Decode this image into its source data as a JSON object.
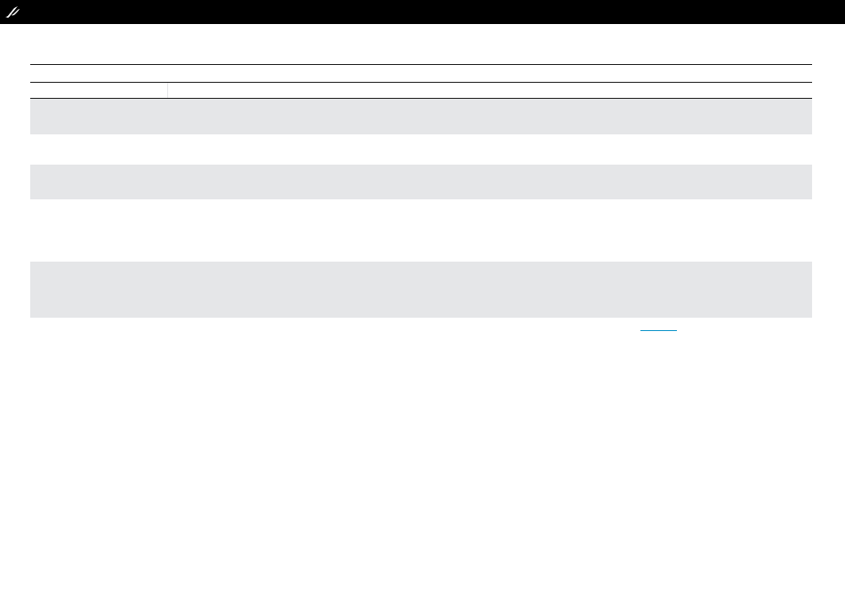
{
  "topbar": {
    "logo_icon": "brand-logo-icon",
    "background": "#000000"
  },
  "table": {
    "headers": [
      "",
      ""
    ],
    "rows": [
      {
        "label": "",
        "value": ""
      },
      {
        "label": "",
        "value": ""
      },
      {
        "label": "",
        "value": ""
      },
      {
        "label": "",
        "value": ""
      },
      {
        "label": "",
        "value": ""
      }
    ],
    "shade_color": "#e5e6e8"
  },
  "link": {
    "label": "",
    "color": "#0a93c8"
  }
}
